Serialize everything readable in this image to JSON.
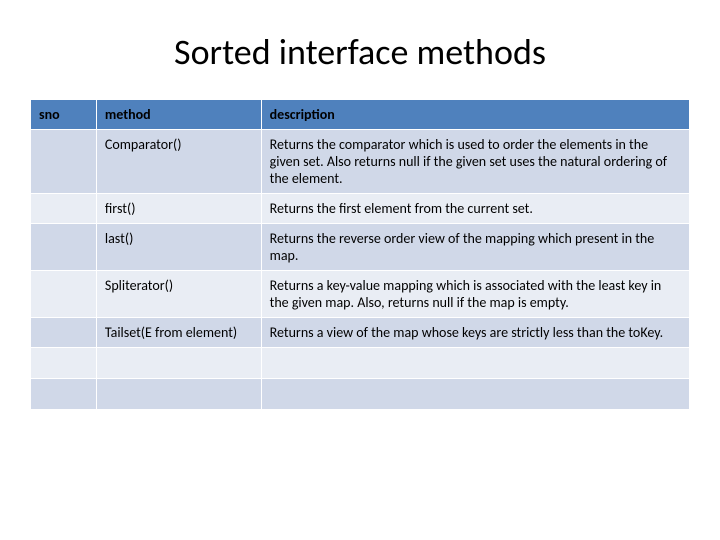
{
  "title": "Sorted interface methods",
  "headers": {
    "sno": "sno",
    "method": "method",
    "description": "description"
  },
  "rows": [
    {
      "sno": "",
      "method": "Comparator()",
      "description": "Returns the comparator which is used to order the elements in the given set. Also returns null if the given set uses the natural ordering of the element."
    },
    {
      "sno": "",
      "method": "first()",
      "description": "Returns the first element from the current set."
    },
    {
      "sno": "",
      "method": "last()",
      "description": "Returns the reverse order view of the mapping which present in the map."
    },
    {
      "sno": "",
      "method": "Spliterator()",
      "description": "Returns a key-value mapping which is associated with the least key in the given map. Also, returns null if the map is empty."
    },
    {
      "sno": "",
      "method": "Tailset(E from element)",
      "description": "Returns a view of the map whose keys are strictly less than the toKey."
    },
    {
      "sno": "",
      "method": "",
      "description": ""
    },
    {
      "sno": "",
      "method": "",
      "description": ""
    }
  ]
}
